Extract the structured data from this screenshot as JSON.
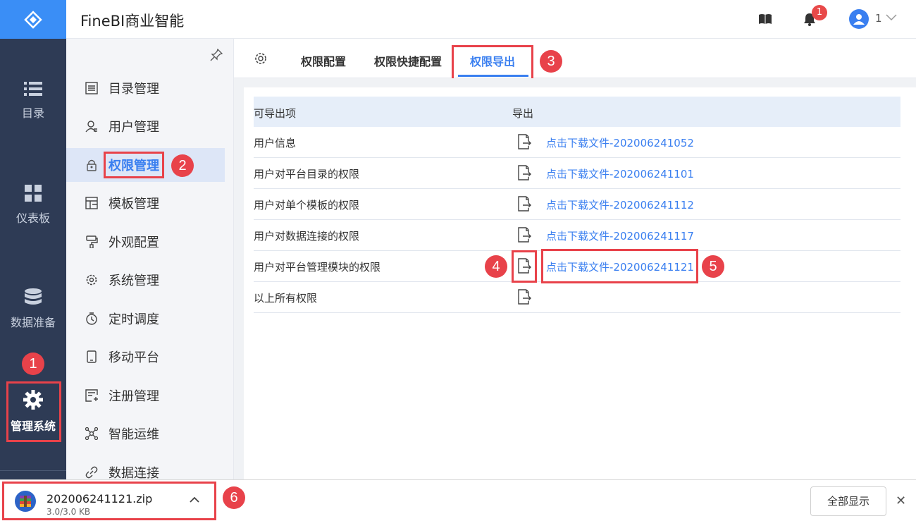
{
  "app": {
    "title": "FineBI商业智能"
  },
  "header": {
    "notification_count": "1",
    "user_name": "1"
  },
  "leftnav": {
    "items": [
      {
        "label": "目录",
        "icon": "list-icon"
      },
      {
        "label": "仪表板",
        "icon": "dashboard-icon"
      },
      {
        "label": "数据准备",
        "icon": "database-icon"
      },
      {
        "label": "管理系统",
        "icon": "gear-icon",
        "active": true
      }
    ]
  },
  "submenu": {
    "items": [
      {
        "label": "目录管理",
        "icon": "catalog-icon"
      },
      {
        "label": "用户管理",
        "icon": "user-icon"
      },
      {
        "label": "权限管理",
        "icon": "lock-icon",
        "active": true
      },
      {
        "label": "模板管理",
        "icon": "template-icon"
      },
      {
        "label": "外观配置",
        "icon": "paint-icon"
      },
      {
        "label": "系统管理",
        "icon": "settings-icon"
      },
      {
        "label": "定时调度",
        "icon": "timer-icon"
      },
      {
        "label": "移动平台",
        "icon": "mobile-icon"
      },
      {
        "label": "注册管理",
        "icon": "register-icon"
      },
      {
        "label": "智能运维",
        "icon": "ops-icon"
      },
      {
        "label": "数据连接",
        "icon": "link-icon"
      }
    ]
  },
  "tabs": [
    {
      "label": "权限配置"
    },
    {
      "label": "权限快捷配置"
    },
    {
      "label": "权限导出",
      "active": true
    }
  ],
  "table": {
    "headers": [
      "可导出项",
      "导出"
    ],
    "rows": [
      {
        "name": "用户信息",
        "link": "点击下载文件-202006241052"
      },
      {
        "name": "用户对平台目录的权限",
        "link": "点击下载文件-202006241101"
      },
      {
        "name": "用户对单个模板的权限",
        "link": "点击下载文件-202006241112"
      },
      {
        "name": "用户对数据连接的权限",
        "link": "点击下载文件-202006241117"
      },
      {
        "name": "用户对平台管理模块的权限",
        "link": "点击下载文件-202006241121"
      },
      {
        "name": "以上所有权限",
        "link": ""
      }
    ]
  },
  "markers": [
    "1",
    "2",
    "3",
    "4",
    "5",
    "6"
  ],
  "download": {
    "filename": "202006241121.zip",
    "size": "3.0/3.0 KB",
    "show_all": "全部显示",
    "close": "✕"
  },
  "colors": {
    "accent": "#3a7ff0",
    "nav_bg": "#2e3b55",
    "annotation_red": "#e8424a"
  }
}
